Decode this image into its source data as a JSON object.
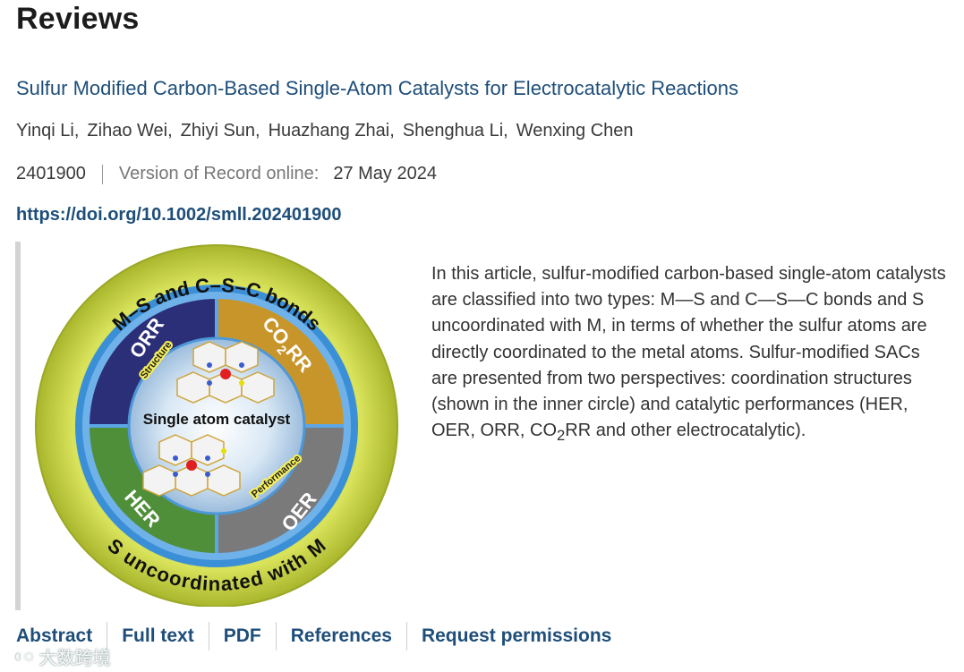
{
  "section": {
    "title": "Reviews"
  },
  "article": {
    "title": "Sulfur Modified Carbon-Based Single-Atom Catalysts for Electrocatalytic Reactions",
    "authors": [
      "Yinqi Li",
      "Zihao Wei",
      "Zhiyi Sun",
      "Huazhang Zhai",
      "Shenghua Li",
      "Wenxing Chen"
    ],
    "author_sep": ",",
    "article_number": "2401900",
    "vor_label": "Version of Record online:",
    "vor_date": "27 May 2024",
    "doi": "https://doi.org/10.1002/smll.202401900",
    "abstract_before": "In this article, sulfur-modified carbon-based single-atom catalysts are classified into two types: M—S and C—S—C bonds and S uncoordinated with M, in terms of whether the sulfur atoms are directly coordinated to the metal atoms. Sulfur-modified SACs are presented from two perspectives: coordination structures (shown in the inner circle) and catalytic performances (HER, OER, ORR, CO",
    "abstract_sub": "2",
    "abstract_after": "RR and other electrocatalytic)."
  },
  "graphic": {
    "top_ring_text": "M–S and C–S–C bonds",
    "bottom_ring_text": "S uncoordinated with M",
    "quadrants": {
      "orr": "ORR",
      "co2rr_main": "CO",
      "co2rr_sub": "2",
      "co2rr_end": "RR",
      "her": "HER",
      "oer": "OER"
    },
    "center_label": "Single atom catalyst",
    "structure_label": "Structure",
    "performance_label": "Performance"
  },
  "tabs": [
    "Abstract",
    "Full text",
    "PDF",
    "References",
    "Request permissions"
  ],
  "watermark": {
    "logo": "◐◌",
    "text": "大数跨境"
  },
  "colors": {
    "link": "#1e4e79",
    "ring_outer": "#cbd84a",
    "ring_blue": "#3b8fd6",
    "orr": "#2b2f78",
    "co2rr": "#c8952a",
    "her": "#4f8f3a",
    "oer": "#7a7a7a",
    "center": "#b9d3ea"
  }
}
